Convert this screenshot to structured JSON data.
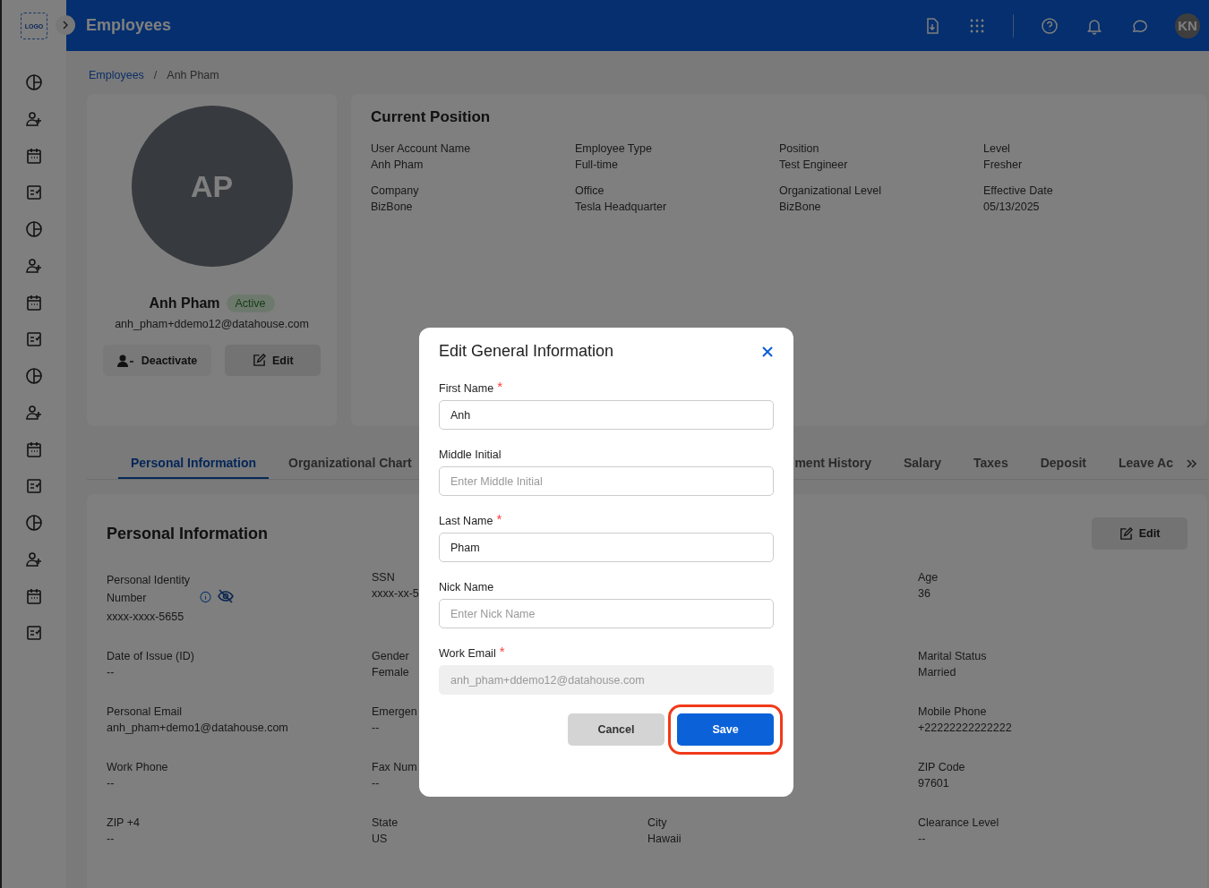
{
  "header": {
    "logo": "LOGO",
    "title": "Employees",
    "avatar": "KN"
  },
  "breadcrumb": {
    "items": [
      "Employees",
      "Anh Pham"
    ],
    "separator": "/"
  },
  "profile": {
    "initials": "AP",
    "name": "Anh Pham",
    "status": "Active",
    "email": "anh_pham+ddemo12@datahouse.com",
    "buttons": [
      "Deactivate",
      "Edit"
    ]
  },
  "current_position": {
    "title": "Current Position",
    "fields": [
      {
        "label": "User Account Name",
        "value": "Anh Pham"
      },
      {
        "label": "Employee Type",
        "value": "Full-time"
      },
      {
        "label": "Position",
        "value": "Test Engineer"
      },
      {
        "label": "Level",
        "value": "Fresher"
      },
      {
        "label": "Company",
        "value": "BizBone"
      },
      {
        "label": "Office",
        "value": "Tesla Headquarter"
      },
      {
        "label": "Organizational Level",
        "value": "BizBone"
      },
      {
        "label": "Effective Date",
        "value": "05/13/2025"
      }
    ]
  },
  "tabs": {
    "leading": [
      {
        "label": "Personal Information",
        "selected": true
      },
      {
        "label": "Organizational Chart",
        "selected": false
      }
    ],
    "trailing": [
      {
        "label": "ment History",
        "selected": false
      },
      {
        "label": "Salary",
        "selected": false
      },
      {
        "label": "Taxes",
        "selected": false
      },
      {
        "label": "Deposit",
        "selected": false
      },
      {
        "label": "Leave Ac",
        "selected": false
      }
    ]
  },
  "personal_information": {
    "title": "Personal Information",
    "edit_button": "Edit",
    "rows": [
      [
        {
          "label": "Personal Identity Number",
          "value": "xxxx-xxxx-5655",
          "kind": "masked"
        },
        {
          "label": "SSN",
          "value": "xxxx-xx-5",
          "kind": "plain"
        },
        null,
        {
          "label": "Age",
          "value": "36",
          "kind": "plain"
        }
      ],
      [
        {
          "label": "Date of Issue (ID)",
          "value": "--",
          "kind": "plain"
        },
        {
          "label": "Gender",
          "value": "Female",
          "kind": "plain"
        },
        null,
        {
          "label": "Marital Status",
          "value": "Married",
          "kind": "plain"
        }
      ],
      [
        {
          "label": "Personal Email",
          "value": "anh_pham+demo1@datahouse.com",
          "kind": "plain"
        },
        {
          "label": "Emergen",
          "value": "--",
          "kind": "plain"
        },
        null,
        {
          "label": "Mobile Phone",
          "value": "+22222222222222",
          "kind": "plain"
        }
      ],
      [
        {
          "label": "Work Phone",
          "value": "--",
          "kind": "plain"
        },
        {
          "label": "Fax Num",
          "value": "--",
          "kind": "plain"
        },
        null,
        {
          "label": "ZIP Code",
          "value": "97601",
          "kind": "plain"
        }
      ],
      [
        {
          "label": "ZIP +4",
          "value": "--",
          "kind": "plain"
        },
        {
          "label": "State",
          "value": "US",
          "kind": "plain"
        },
        {
          "label": "City",
          "value": "Hawaii",
          "kind": "plain"
        },
        {
          "label": "Clearance Level",
          "value": "--",
          "kind": "plain"
        }
      ]
    ]
  },
  "dialog": {
    "title": "Edit General Information",
    "fields": [
      {
        "label": "First Name",
        "required_mark": "*",
        "value": "Anh",
        "disabled": false
      },
      {
        "label": "Middle Initial",
        "placeholder": "Enter Middle Initial",
        "disabled": false
      },
      {
        "label": "Last Name",
        "required_mark": "*",
        "value": "Pham",
        "disabled": false
      },
      {
        "label": "Nick Name",
        "placeholder": "Enter Nick Name",
        "disabled": false
      },
      {
        "label": "Work Email",
        "required_mark": "*",
        "value": "anh_pham+ddemo12@datahouse.com",
        "disabled": true
      }
    ],
    "cancel": "Cancel",
    "save": {
      "label": "Save",
      "highlighted": true
    }
  }
}
